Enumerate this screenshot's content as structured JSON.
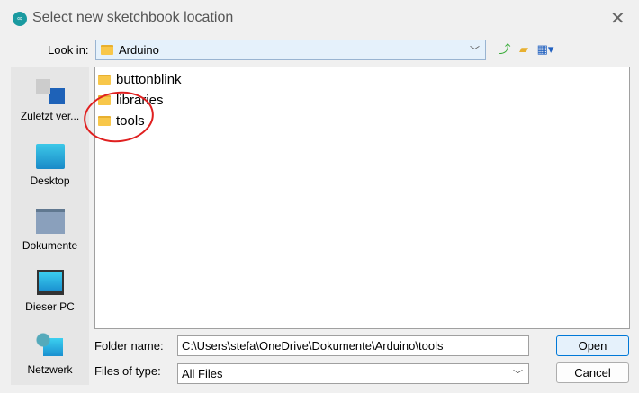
{
  "window": {
    "title": "Select new sketchbook location",
    "close_icon": "close-icon"
  },
  "look_in": {
    "label": "Look in:",
    "value": "Arduino"
  },
  "toolbar": {
    "icons": [
      "up-folder-icon",
      "new-folder-icon",
      "view-menu-icon"
    ]
  },
  "sidebar": {
    "items": [
      {
        "label": "Zuletzt ver...",
        "icon": "recent-icon"
      },
      {
        "label": "Desktop",
        "icon": "desktop-icon"
      },
      {
        "label": "Dokumente",
        "icon": "documents-icon"
      },
      {
        "label": "Dieser PC",
        "icon": "computer-icon"
      },
      {
        "label": "Netzwerk",
        "icon": "network-icon"
      }
    ]
  },
  "files": [
    {
      "name": "buttonblink"
    },
    {
      "name": "libraries"
    },
    {
      "name": "tools"
    }
  ],
  "folder_name": {
    "label": "Folder name:",
    "value": "C:\\Users\\stefa\\OneDrive\\Dokumente\\Arduino\\tools"
  },
  "files_of_type": {
    "label": "Files of type:",
    "value": "All Files"
  },
  "buttons": {
    "open": "Open",
    "cancel": "Cancel"
  },
  "annotation_color": "#e02020"
}
